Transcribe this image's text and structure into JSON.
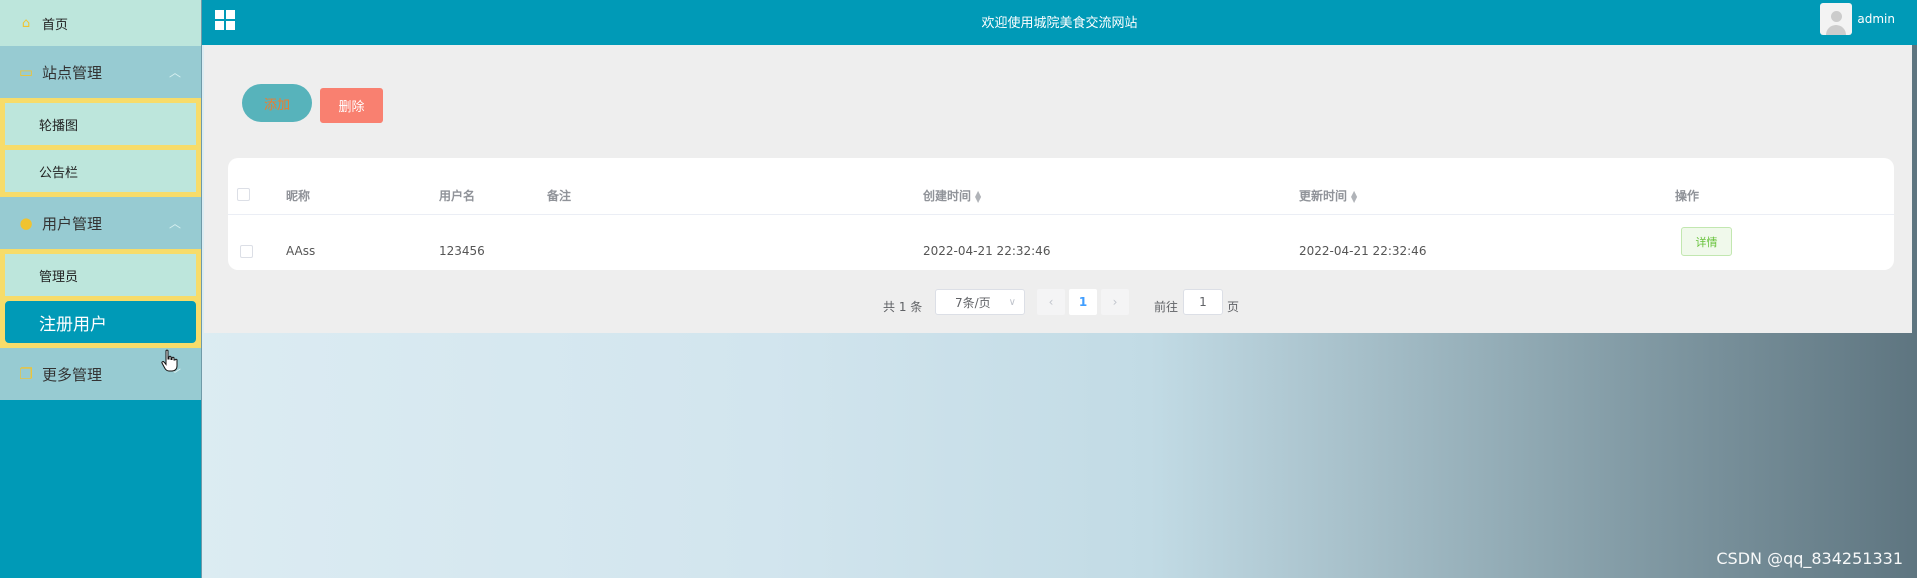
{
  "header": {
    "title": "欢迎使用城院美食交流网站",
    "user_name": "admin"
  },
  "sidebar": {
    "home": "首页",
    "groups": [
      {
        "label": "站点管理",
        "items": [
          "轮播图",
          "公告栏"
        ]
      },
      {
        "label": "用户管理",
        "items": [
          "管理员",
          "注册用户"
        ]
      },
      {
        "label": "更多管理",
        "items": []
      }
    ],
    "active_item": "注册用户"
  },
  "toolbar": {
    "add_label": "添加",
    "delete_label": "删除"
  },
  "table": {
    "columns": [
      "昵称",
      "用户名",
      "备注",
      "创建时间",
      "更新时间",
      "操作"
    ],
    "rows": [
      {
        "nickname": "AAss",
        "username": "123456",
        "remark": "",
        "created": "2022-04-21 22:32:46",
        "updated": "2022-04-21 22:32:46",
        "action": "详情"
      }
    ]
  },
  "pagination": {
    "total": "共 1 条",
    "page_size": "7条/页",
    "current_page": "1",
    "goto_label": "前往",
    "goto_value": "1",
    "page_unit": "页"
  },
  "watermark": "CSDN @qq_834251331",
  "colors": {
    "primary": "#009ab7",
    "menu_bg": "#bde6dc",
    "menu_group_bg": "#97cbd2",
    "highlight_border": "#f7dc6a",
    "delete": "#f98070",
    "success": "#67c23a"
  }
}
